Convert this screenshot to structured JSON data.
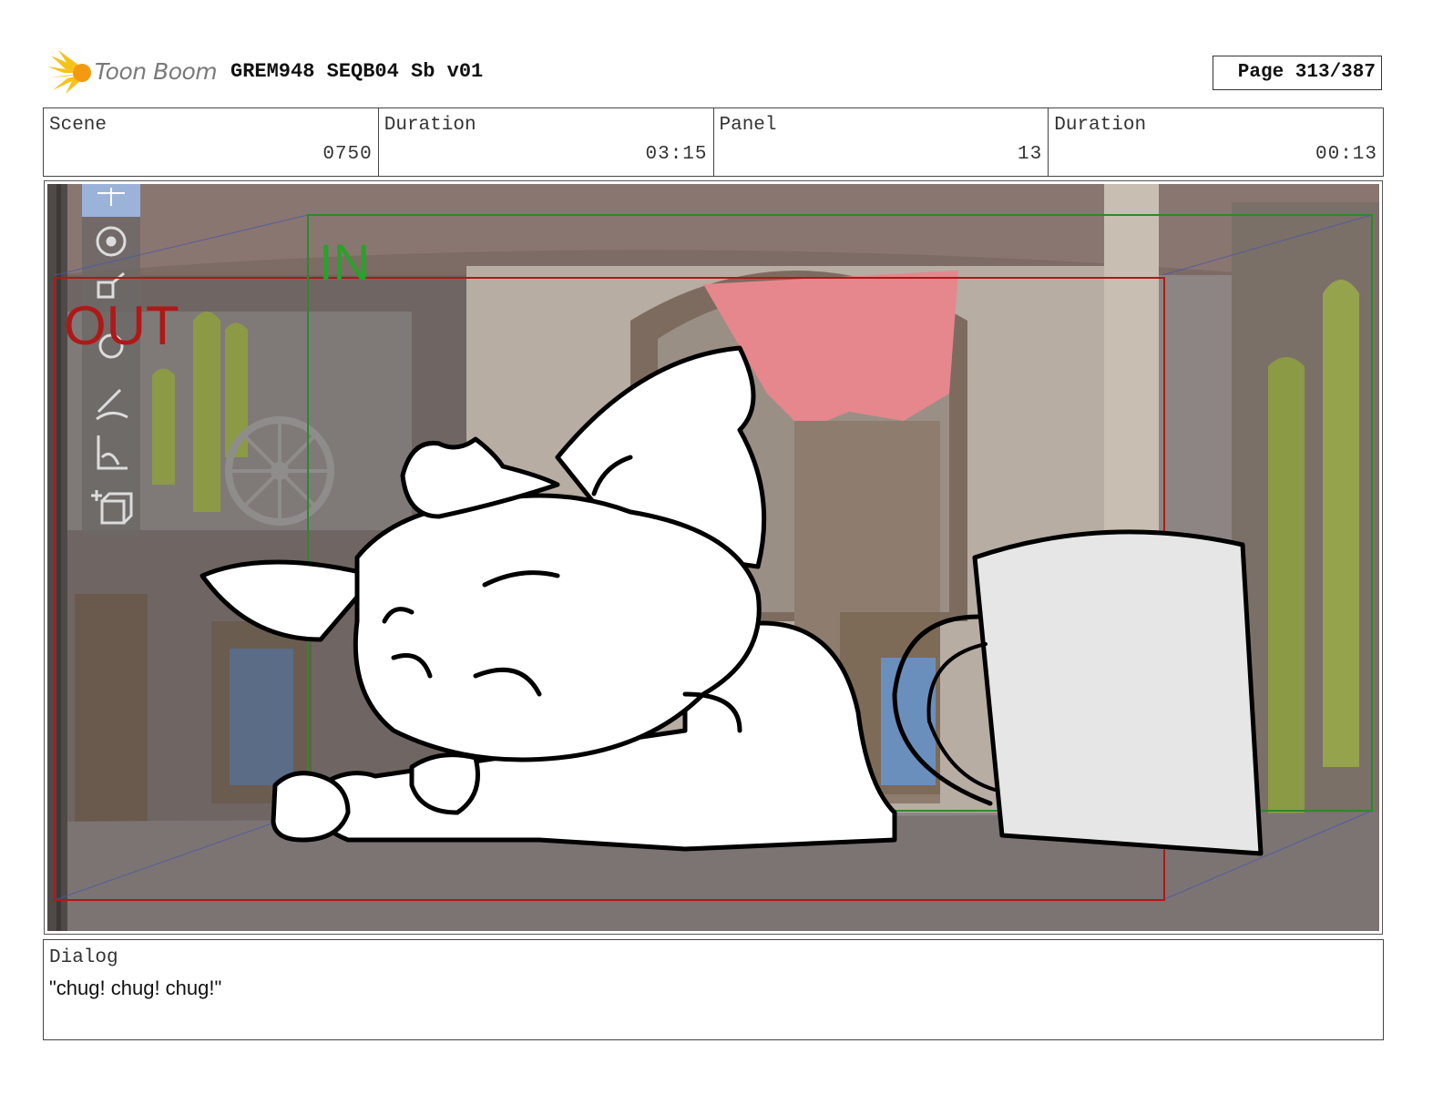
{
  "header": {
    "logo_text": "Toon Boom",
    "doc_title": "GREM948 SEQB04 Sb v01",
    "page": "Page 313/387"
  },
  "info": {
    "scene_label": "Scene",
    "scene_value": "0750",
    "scene_duration_label": "Duration",
    "scene_duration_value": "03:15",
    "panel_label": "Panel",
    "panel_value": "13",
    "panel_duration_label": "Duration",
    "panel_duration_value": "00:13"
  },
  "panel": {
    "in_label": "IN",
    "out_label": "OUT",
    "in_color": "#2a9a2a",
    "out_color": "#b01818",
    "tools": [
      "move-tool-icon",
      "rotate-tool-icon",
      "scale-tool-icon",
      "pivot-tool-icon",
      "pencil-tool-icon",
      "ruler-tool-icon",
      "add-3d-object-icon"
    ]
  },
  "dialog": {
    "label": "Dialog",
    "text": "\"chug! chug! chug!\""
  }
}
